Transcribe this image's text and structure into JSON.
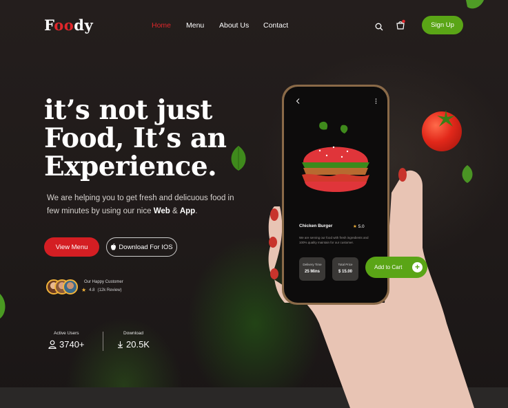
{
  "brand": {
    "logo_first": "F",
    "logo_accent": "oo",
    "logo_rest": "dy",
    "accent_color": "#e0272b",
    "green": "#5aa516"
  },
  "nav": {
    "items": [
      "Home",
      "Menu",
      "About Us",
      "Contact"
    ],
    "active": "Home",
    "signup": "Sign Up"
  },
  "hero": {
    "title_lines": [
      "it’s not just",
      "Food, It’s an",
      "Experience."
    ],
    "desc_pre": "We are helping you to get fresh and delicuous food in few minutes by using our nice ",
    "desc_web": "Web",
    "desc_amp": " & ",
    "desc_app": "App",
    "desc_end": ".",
    "btn_menu": "View Menu",
    "btn_ios": "Download For IOS",
    "customers_label": "Our Happy Customer",
    "rating": "4.8",
    "reviews": "(12k Review)"
  },
  "stats": [
    {
      "label": "Active Users",
      "value": "3740+",
      "icon": "user-icon"
    },
    {
      "label": "Download",
      "value": "20.5K",
      "icon": "download-icon"
    }
  ],
  "phone": {
    "item_name": "Chicken Burger",
    "item_rating": "5.0",
    "item_desc": "We are serving our food with fresh ingredients and 100% quality maintain for our customer.",
    "delivery_label": "Delivery Time",
    "delivery_value": "25 Mins",
    "price_label": "Total Price",
    "price_value": "$ 15.00",
    "cart_label": "Add to Cart"
  }
}
